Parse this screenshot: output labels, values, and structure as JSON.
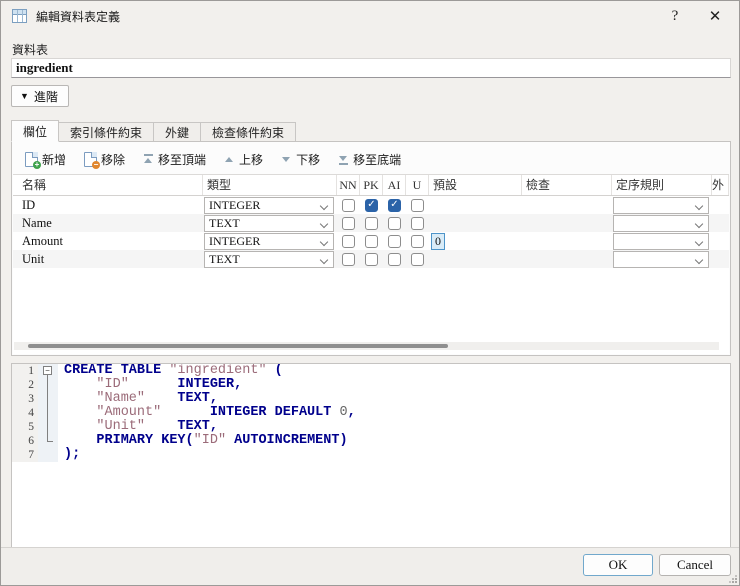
{
  "dialog": {
    "title": "編輯資料表定義",
    "help_label": "?",
    "close_label": "✕"
  },
  "table_section": {
    "label": "資料表",
    "name_value": "ingredient",
    "advanced_label": "進階",
    "advanced_arrow": "▼"
  },
  "tabs": [
    {
      "label": "欄位",
      "active": true
    },
    {
      "label": "索引條件約束",
      "active": false
    },
    {
      "label": "外鍵",
      "active": false
    },
    {
      "label": "檢查條件約束",
      "active": false
    }
  ],
  "toolbar": [
    {
      "label": "新增",
      "icon": "document-plus-icon"
    },
    {
      "label": "移除",
      "icon": "document-minus-icon"
    },
    {
      "label": "移至頂端",
      "icon": "move-top-icon"
    },
    {
      "label": "上移",
      "icon": "arrow-up-icon"
    },
    {
      "label": "下移",
      "icon": "arrow-down-icon"
    },
    {
      "label": "移至底端",
      "icon": "move-bottom-icon"
    }
  ],
  "grid": {
    "headers": [
      "名稱",
      "類型",
      "NN",
      "PK",
      "AI",
      "U",
      "預設",
      "檢查",
      "定序規則",
      "外"
    ],
    "rows": [
      {
        "name": "ID",
        "type": "INTEGER",
        "nn": false,
        "pk": true,
        "ai": true,
        "u": false,
        "default": "",
        "default_selected": false,
        "check": "",
        "collation": ""
      },
      {
        "name": "Name",
        "type": "TEXT",
        "nn": false,
        "pk": false,
        "ai": false,
        "u": false,
        "default": "",
        "default_selected": false,
        "check": "",
        "collation": ""
      },
      {
        "name": "Amount",
        "type": "INTEGER",
        "nn": false,
        "pk": false,
        "ai": false,
        "u": false,
        "default": "0",
        "default_selected": true,
        "check": "",
        "collation": ""
      },
      {
        "name": "Unit",
        "type": "TEXT",
        "nn": false,
        "pk": false,
        "ai": false,
        "u": false,
        "default": "",
        "default_selected": false,
        "check": "",
        "collation": ""
      }
    ]
  },
  "sql": {
    "fold_minus": "−",
    "lines": [
      {
        "num": "1",
        "fold": "box",
        "segments": [
          {
            "t": "CREATE TABLE ",
            "c": "kw"
          },
          {
            "t": "\"ingredient\"",
            "c": "id"
          },
          {
            "t": " (",
            "c": "pn"
          }
        ]
      },
      {
        "num": "2",
        "fold": "line",
        "segments": [
          {
            "t": "    ",
            "c": ""
          },
          {
            "t": "\"ID\"",
            "c": "id"
          },
          {
            "t": "      ",
            "c": ""
          },
          {
            "t": "INTEGER",
            "c": "kw"
          },
          {
            "t": ",",
            "c": "pn"
          }
        ]
      },
      {
        "num": "3",
        "fold": "line",
        "segments": [
          {
            "t": "    ",
            "c": ""
          },
          {
            "t": "\"Name\"",
            "c": "id"
          },
          {
            "t": "    ",
            "c": ""
          },
          {
            "t": "TEXT",
            "c": "kw"
          },
          {
            "t": ",",
            "c": "pn"
          }
        ]
      },
      {
        "num": "4",
        "fold": "line",
        "segments": [
          {
            "t": "    ",
            "c": ""
          },
          {
            "t": "\"Amount\"",
            "c": "id"
          },
          {
            "t": "      ",
            "c": ""
          },
          {
            "t": "INTEGER",
            "c": "kw"
          },
          {
            "t": " ",
            "c": ""
          },
          {
            "t": "DEFAULT",
            "c": "kw"
          },
          {
            "t": " ",
            "c": ""
          },
          {
            "t": "0",
            "c": "num"
          },
          {
            "t": ",",
            "c": "pn"
          }
        ]
      },
      {
        "num": "5",
        "fold": "line",
        "segments": [
          {
            "t": "    ",
            "c": ""
          },
          {
            "t": "\"Unit\"",
            "c": "id"
          },
          {
            "t": "    ",
            "c": ""
          },
          {
            "t": "TEXT",
            "c": "kw"
          },
          {
            "t": ",",
            "c": "pn"
          }
        ]
      },
      {
        "num": "6",
        "fold": "corner",
        "segments": [
          {
            "t": "    ",
            "c": ""
          },
          {
            "t": "PRIMARY KEY",
            "c": "kw"
          },
          {
            "t": "(",
            "c": "pn"
          },
          {
            "t": "\"ID\"",
            "c": "id"
          },
          {
            "t": " ",
            "c": ""
          },
          {
            "t": "AUTOINCREMENT",
            "c": "kw"
          },
          {
            "t": ")",
            "c": "pn"
          }
        ]
      },
      {
        "num": "7",
        "fold": "none",
        "segments": [
          {
            "t": ");",
            "c": "pn"
          }
        ]
      }
    ]
  },
  "footer": {
    "ok_label": "OK",
    "cancel_label": "Cancel"
  }
}
